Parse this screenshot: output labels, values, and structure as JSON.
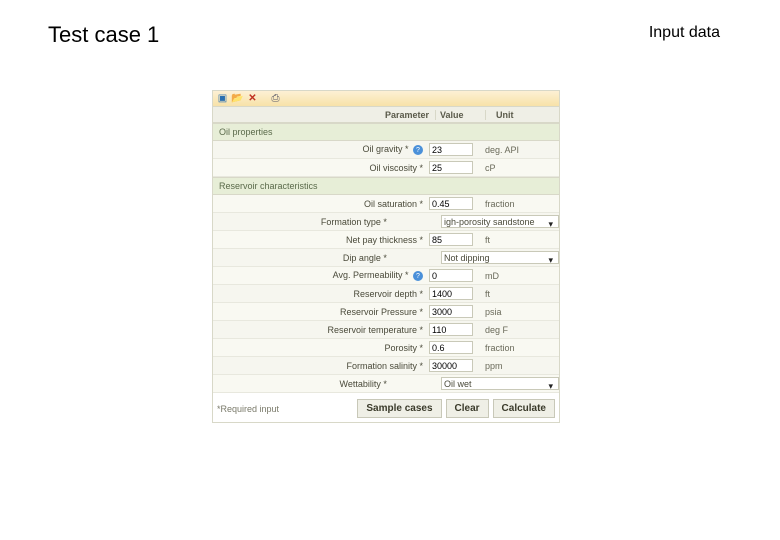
{
  "slide": {
    "title": "Test case 1",
    "right": "Input data"
  },
  "toolbar": {
    "save": "save-icon",
    "open": "open-icon",
    "delete": "delete-icon",
    "print": "print-icon"
  },
  "headers": {
    "param": "Parameter",
    "value": "Value",
    "unit": "Unit"
  },
  "sections": {
    "oil": "Oil properties",
    "res": "Reservoir characteristics"
  },
  "rows": {
    "oil_gravity": {
      "label": "Oil gravity *",
      "value": "23",
      "unit": "deg. API",
      "help": true
    },
    "oil_viscosity": {
      "label": "Oil viscosity *",
      "value": "25",
      "unit": "cP"
    },
    "oil_saturation": {
      "label": "Oil saturation *",
      "value": "0.45",
      "unit": "fraction"
    },
    "formation_type": {
      "label": "Formation type *",
      "value": "igh-porosity sandstone",
      "select": true
    },
    "net_pay": {
      "label": "Net pay thickness *",
      "value": "85",
      "unit": "ft"
    },
    "dip_angle": {
      "label": "Dip angle *",
      "value": "Not dipping",
      "select": true
    },
    "avg_perm": {
      "label": "Avg. Permeability *",
      "value": "0",
      "unit": "mD",
      "help": true
    },
    "res_depth": {
      "label": "Reservoir depth *",
      "value": "1400",
      "unit": "ft"
    },
    "res_pressure": {
      "label": "Reservoir Pressure *",
      "value": "3000",
      "unit": "psia"
    },
    "res_temp": {
      "label": "Reservoir temperature *",
      "value": "110",
      "unit": "deg F"
    },
    "porosity": {
      "label": "Porosity *",
      "value": "0.6",
      "unit": "fraction"
    },
    "salinity": {
      "label": "Formation salinity *",
      "value": "30000",
      "unit": "ppm"
    },
    "wettability": {
      "label": "Wettability *",
      "value": "Oil wet",
      "select": true
    }
  },
  "footer": {
    "note": "*Required input",
    "sample": "Sample cases",
    "clear": "Clear",
    "calc": "Calculate"
  }
}
